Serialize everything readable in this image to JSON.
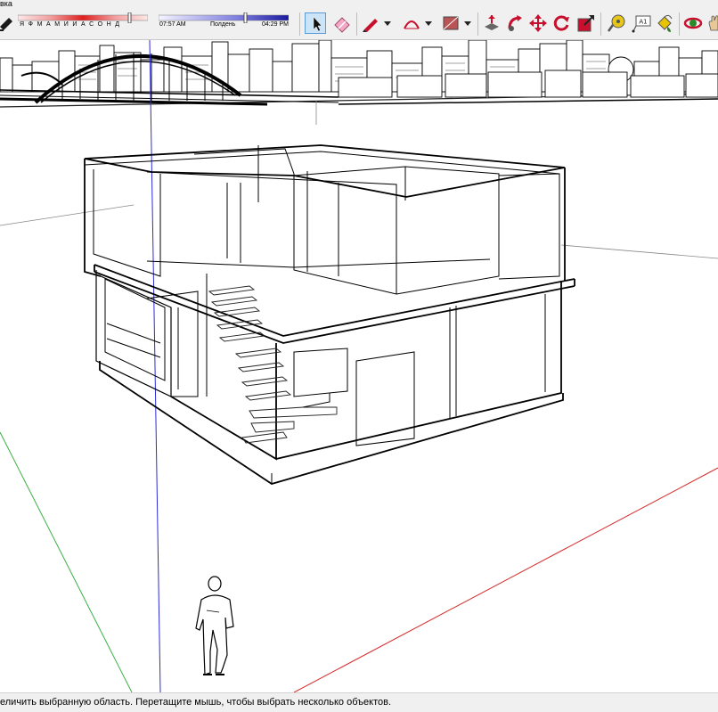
{
  "window": {
    "menu_fragment": "вка"
  },
  "shadow_panel": {
    "months": "ЯФМАМИИАСОНД",
    "time_start": "07:57 AM",
    "time_mid": "Полдень",
    "time_end": "04:29 PM"
  },
  "toolbar": {
    "tools": [
      {
        "name": "select-tool",
        "icon": "arrow-cursor-icon",
        "active": true
      },
      {
        "name": "eraser-tool",
        "icon": "eraser-icon"
      },
      {
        "name": "line-tool",
        "icon": "pencil-icon"
      },
      {
        "name": "arc-tool",
        "icon": "arc-icon"
      },
      {
        "name": "rectangle-tool",
        "icon": "rectangle-icon"
      },
      {
        "name": "push-pull-tool",
        "icon": "push-pull-icon"
      },
      {
        "name": "follow-me-tool",
        "icon": "follow-me-icon"
      },
      {
        "name": "move-tool",
        "icon": "move-icon"
      },
      {
        "name": "rotate-tool",
        "icon": "rotate-icon"
      },
      {
        "name": "scale-tool",
        "icon": "scale-icon"
      },
      {
        "name": "tape-measure-tool",
        "icon": "tape-measure-icon"
      },
      {
        "name": "text-tool",
        "icon": "text-icon"
      },
      {
        "name": "paint-bucket-tool",
        "icon": "paint-bucket-icon"
      },
      {
        "name": "orbit-tool",
        "icon": "orbit-icon"
      }
    ],
    "text_tool_label": "A1"
  },
  "scene": {
    "axis_colors": {
      "blue": "#2b2bd6",
      "green": "#3cb043",
      "red": "#d62b2b"
    }
  },
  "status_bar": {
    "text": "еличить выбранную область. Перетащите мышь, чтобы выбрать несколько объектов."
  }
}
